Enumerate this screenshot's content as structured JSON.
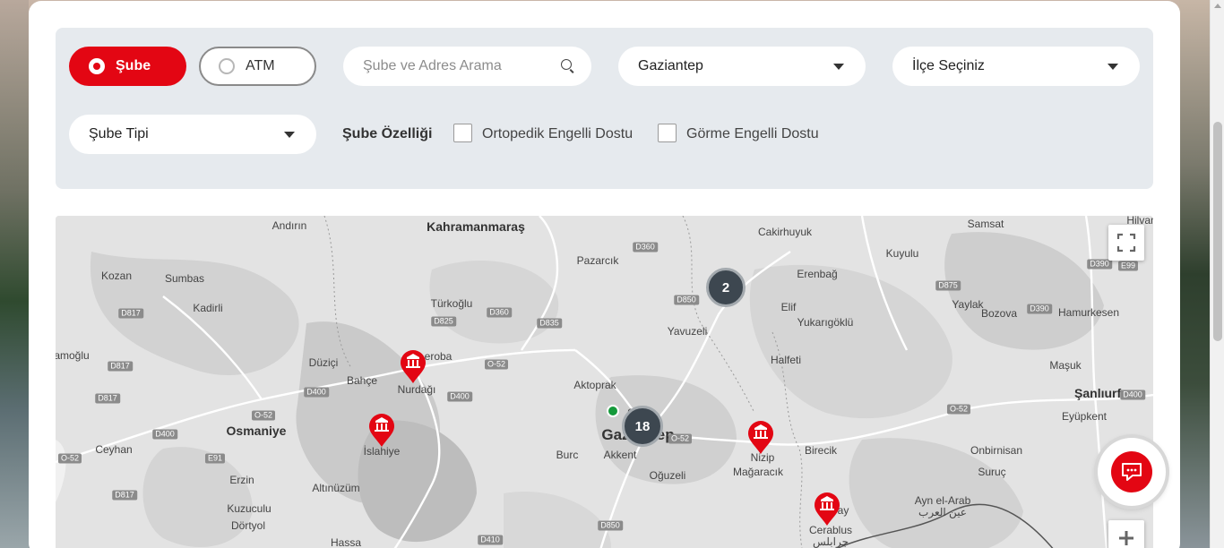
{
  "filters": {
    "type_options": {
      "branch_label": "Şube",
      "atm_label": "ATM",
      "selected": "Şube"
    },
    "search": {
      "placeholder": "Şube ve Adres Arama",
      "value": ""
    },
    "city": {
      "selected": "Gaziantep"
    },
    "district": {
      "selected": "İlçe Seçiniz"
    },
    "branch_type": {
      "selected": "Şube Tipi"
    },
    "features": {
      "label": "Şube Özelliği",
      "orthopedic_label": "Ortopedik Engelli Dostu",
      "orthopedic_checked": false,
      "visual_label": "Görme Engelli Dostu",
      "visual_checked": false
    }
  },
  "map": {
    "cities": {
      "kahramanmaras": "Kahramanmaraş",
      "andirin": "Andırın",
      "cakirhuyuk": "Cakirhuyuk",
      "samsat": "Samsat",
      "hilvan": "Hilvan",
      "kozan": "Kozan",
      "sumbas": "Sumbas",
      "pazarcik": "Pazarcık",
      "erenbag": "Erenbağ",
      "kuyulu": "Kuyulu",
      "kadirli": "Kadirli",
      "turkoglu": "Türkoğlu",
      "elif": "Elif",
      "yukarigoklu": "Yukarıgöklü",
      "yaylak": "Yaylak",
      "bozova": "Bozova",
      "hamurkesen": "Hamurkesen",
      "osmanoglu": "amoğlu",
      "duzici": "Düziçi",
      "yavuzeli": "Yavuzeli",
      "halfeti": "Halfeti",
      "masuk": "Maşuk",
      "bahce": "Bahçe",
      "nurdagi": "Nurdağı",
      "aktoprak": "Aktoprak",
      "sanliurfa": "Şanlıurfa",
      "osmaniye": "Osmaniye",
      "eyupkent": "Eyüpkent",
      "ceyhan": "Ceyhan",
      "islahiye": "İslahiye",
      "gaziantep": "Gaziantep",
      "burc": "Burc",
      "akkent": "Akkent",
      "nizip": "Nizip",
      "birecik": "Birecik",
      "onbirnisan": "Onbirnisan",
      "erzin": "Erzin",
      "oguzeli": "Oğuzeli",
      "magaracik": "Mağaracık",
      "suruc": "Suruç",
      "altinuzum": "Altınüzüm",
      "kuzuculu": "Kuzuculu",
      "dortyol": "Dörtyol",
      "aynelarab": "Ayn el-Arab",
      "aynelarab_ar": "عين العرب",
      "cerablus": "Cerablus",
      "cerablus_ar": "جرابلس",
      "hassa": "Hassa",
      "karkamis": "ay",
      "ceroba": "eroba",
      "ceylan": "eyl"
    },
    "roads": [
      "D360",
      "D850",
      "D390",
      "E99",
      "D875",
      "D817",
      "D825",
      "D360",
      "D835",
      "O-52",
      "D390",
      "D817",
      "D400",
      "D400",
      "D817",
      "O-52",
      "D400",
      "E91",
      "D400",
      "O-52",
      "O-52",
      "O-52",
      "D817",
      "D850",
      "D410",
      "D400"
    ],
    "clusters": [
      "2",
      "18"
    ]
  },
  "colors": {
    "accent": "#e30613",
    "cluster": "#3d4750",
    "location_dot": "#159a3b"
  }
}
